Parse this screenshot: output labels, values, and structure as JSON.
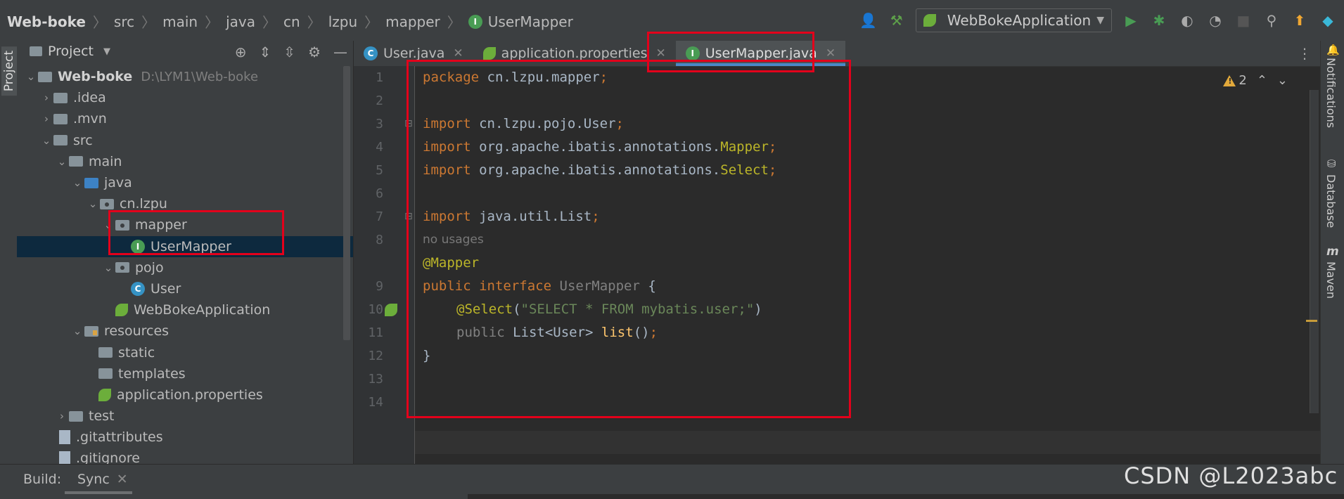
{
  "breadcrumb": {
    "items": [
      "Web-boke",
      "src",
      "main",
      "java",
      "cn",
      "lzpu",
      "mapper"
    ],
    "current": "UserMapper",
    "current_badge": "I"
  },
  "toolbar": {
    "run_config": "WebBokeApplication",
    "icons": [
      "user-icon",
      "build-hammer-icon",
      "run-icon",
      "debug-icon",
      "coverage-icon",
      "profile-icon",
      "stop-icon",
      "search-icon",
      "update-icon",
      "toolbox-icon"
    ]
  },
  "left_strip": {
    "label": "Project"
  },
  "project_panel": {
    "title": "Project",
    "tree": [
      {
        "label": "Web-boke",
        "hint": "D:\\LYM1\\Web-boke",
        "depth": 0,
        "icon": "module",
        "expanded": true
      },
      {
        "label": ".idea",
        "depth": 1,
        "icon": "folder",
        "expanded": false
      },
      {
        "label": ".mvn",
        "depth": 1,
        "icon": "folder",
        "expanded": false
      },
      {
        "label": "src",
        "depth": 1,
        "icon": "folder",
        "expanded": true
      },
      {
        "label": "main",
        "depth": 2,
        "icon": "folder",
        "expanded": true
      },
      {
        "label": "java",
        "depth": 3,
        "icon": "folder-blue",
        "expanded": true
      },
      {
        "label": "cn.lzpu",
        "depth": 4,
        "icon": "package",
        "expanded": true
      },
      {
        "label": "mapper",
        "depth": 5,
        "icon": "package",
        "expanded": true
      },
      {
        "label": "UserMapper",
        "depth": 6,
        "icon": "interface",
        "selected": true
      },
      {
        "label": "pojo",
        "depth": 5,
        "icon": "package",
        "expanded": true
      },
      {
        "label": "User",
        "depth": 6,
        "icon": "class"
      },
      {
        "label": "WebBokeApplication",
        "depth": 5,
        "icon": "spring-class"
      },
      {
        "label": "resources",
        "depth": 3,
        "icon": "folder-res",
        "expanded": true
      },
      {
        "label": "static",
        "depth": 4,
        "icon": "folder"
      },
      {
        "label": "templates",
        "depth": 4,
        "icon": "folder"
      },
      {
        "label": "application.properties",
        "depth": 4,
        "icon": "spring-properties"
      },
      {
        "label": "test",
        "depth": 2,
        "icon": "folder",
        "expanded": false
      },
      {
        "label": ".gitattributes",
        "depth": 1,
        "icon": "file"
      },
      {
        "label": ".gitignore",
        "depth": 1,
        "icon": "file"
      }
    ]
  },
  "editor": {
    "tabs": [
      {
        "label": "User.java",
        "icon": "C",
        "active": false
      },
      {
        "label": "application.properties",
        "icon": "spring",
        "active": false
      },
      {
        "label": "UserMapper.java",
        "icon": "I",
        "active": true
      }
    ],
    "warning_count": "2",
    "gutter_numbers": [
      "1",
      "2",
      "3",
      "4",
      "5",
      "6",
      "7",
      "8",
      "9",
      "10",
      "11",
      "12",
      "13",
      "14"
    ],
    "code": {
      "line1": [
        "package",
        " cn.lzpu.mapper",
        ";"
      ],
      "line3": [
        "import",
        " cn.lzpu.pojo.User",
        ";"
      ],
      "line4": [
        "import",
        " org.apache.ibatis.annotations.",
        "Mapper",
        ";"
      ],
      "line5": [
        "import",
        " org.apache.ibatis.annotations.",
        "Select",
        ";"
      ],
      "line7": [
        "import",
        " java.util.List",
        ";"
      ],
      "usage_hint": "no usages",
      "line9": "@Mapper",
      "line10": [
        "public",
        " ",
        "interface",
        " ",
        "UserMapper",
        " {"
      ],
      "line11": [
        "@Select",
        "(",
        "\"SELECT * FROM mybatis.user;\"",
        ")"
      ],
      "line12": [
        "public",
        " List<User> ",
        "list",
        "()",
        ";"
      ],
      "line13": "}"
    }
  },
  "right_strip": {
    "labels": [
      "Notifications",
      "Database",
      "Maven"
    ]
  },
  "bottom_bar": {
    "build": "Build:",
    "sync": "Sync"
  },
  "watermark": "CSDN @L2023abc",
  "colors": {
    "keyword": "#cc7832",
    "annotation": "#bbb529",
    "string": "#6a8759",
    "method": "#ffc66d",
    "highlight_box": "#e3001b"
  }
}
